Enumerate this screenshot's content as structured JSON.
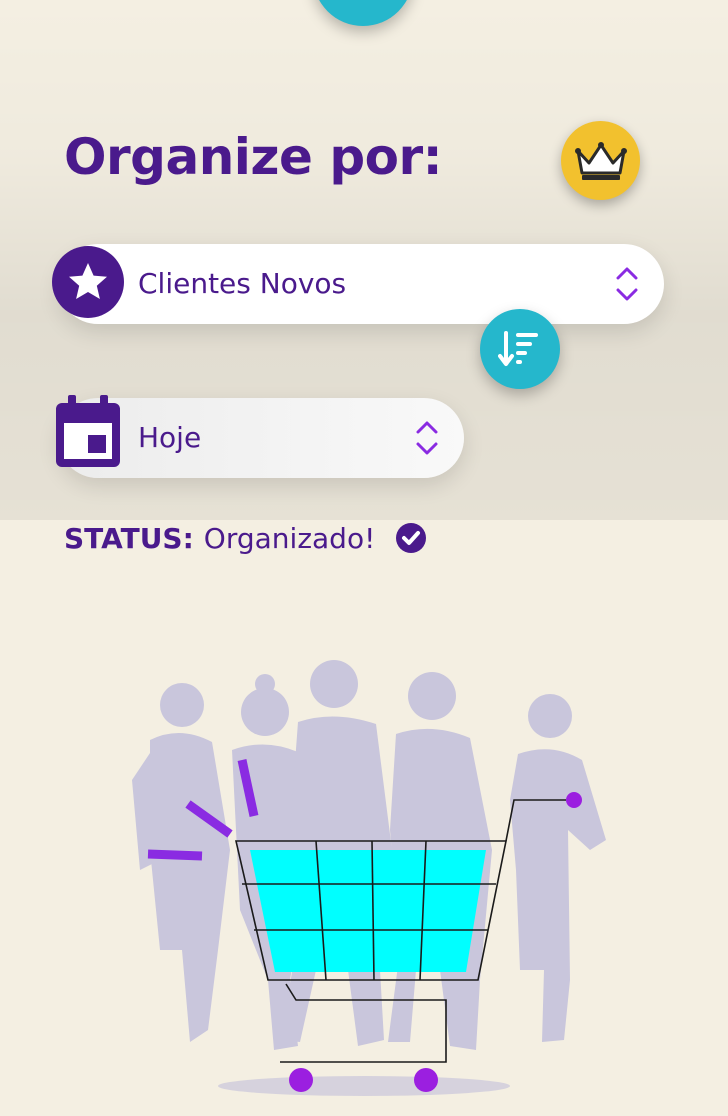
{
  "header": {
    "title": "Organize por:",
    "premium_icon": "crown-icon"
  },
  "sort_select": {
    "icon": "star-icon",
    "value": "Clientes Novos",
    "chevron_icon": "chevron-updown-icon"
  },
  "sort_button": {
    "icon": "sort-descending-icon"
  },
  "date_select": {
    "icon": "calendar-icon",
    "value": "Hoje",
    "chevron_icon": "chevron-updown-icon"
  },
  "status": {
    "label": "STATUS:",
    "value": "Organizado!",
    "icon": "check-circle-icon"
  },
  "colors": {
    "primary": "#4a1a8c",
    "accent_cyan": "#25b7cc",
    "gold": "#f2c12e",
    "background": "#f4efe2",
    "cart_fill": "#00ffff",
    "silhouette": "#c9c6dc",
    "purple_accent": "#8a2be2"
  },
  "illustration": {
    "subject": "people-with-shopping-cart"
  }
}
